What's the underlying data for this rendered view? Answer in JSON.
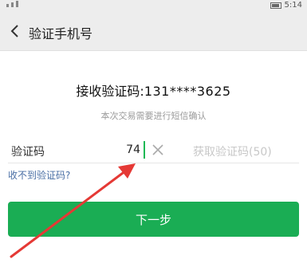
{
  "status_bar": {
    "time": "5:14"
  },
  "header": {
    "title": "验证手机号"
  },
  "main": {
    "receive_label": "接收验证码:",
    "phone": "131****3625",
    "notice": "本次交易需要进行短信确认",
    "code_label": "验证码",
    "code_value": "74",
    "get_code_label": "获取验证码(50)",
    "not_received_link": "收不到验证码?",
    "next_button": "下一步"
  },
  "colors": {
    "accent": "#1aad54",
    "annotation": "#e53935"
  },
  "icons": [
    "back-icon",
    "clear-icon",
    "annotation-arrow"
  ]
}
